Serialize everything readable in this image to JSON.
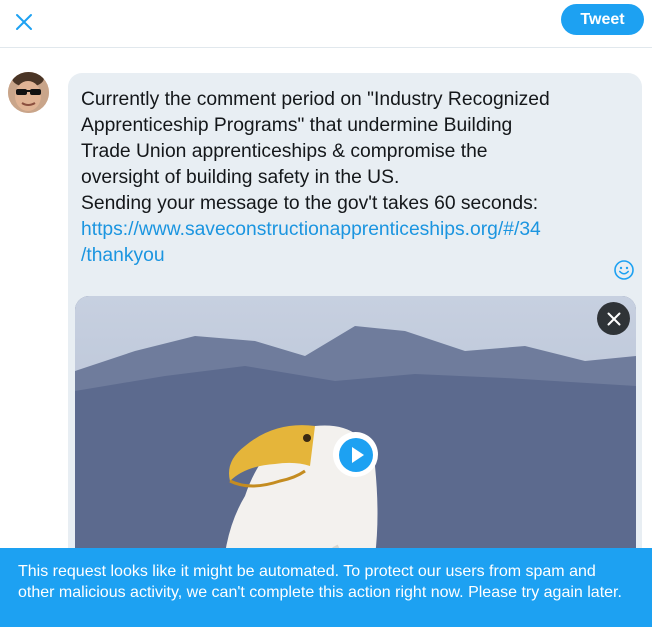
{
  "header": {
    "close_icon": "close-icon",
    "tweet_label": "Tweet"
  },
  "compose": {
    "text_line1": "Currently the comment period on \"Industry Recognized",
    "text_line2": "Apprenticeship Programs\" that undermine Building",
    "text_line3": "Trade Union apprenticeships & compromise the",
    "text_line4": "oversight of building safety in the US.",
    "text_line5": "Sending your message to the gov't takes 60 seconds:",
    "link_line1": "https://www.saveconstructionapprenticeships.org/#/34",
    "link_line2": "/thankyou",
    "emoji_icon": "smiley-icon",
    "media_remove_icon": "close-icon",
    "play_icon": "play-icon"
  },
  "alert": {
    "message": "This request looks like it might be automated. To protect our users from spam and other malicious activity, we can't complete this action right now. Please try again later."
  },
  "colors": {
    "accent": "#1da1f2",
    "link": "#1b95e0",
    "compose_bg": "#e8eef3"
  }
}
